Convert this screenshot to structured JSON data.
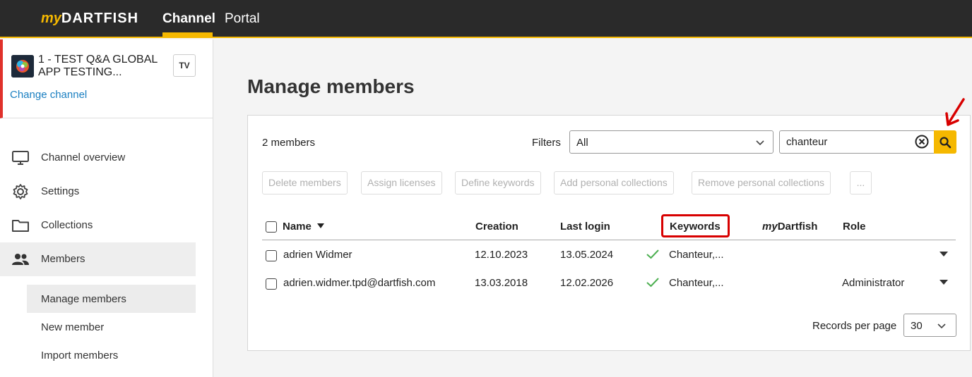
{
  "topbar": {
    "logo_my": "my",
    "logo_brand": "DARTFISH",
    "nav": {
      "channel": "Channel",
      "portal": "Portal"
    }
  },
  "sidebar": {
    "channel_name": "1 - TEST Q&A GLOBAL APP TESTING...",
    "tv_label": "TV",
    "change_channel": "Change channel",
    "menu": [
      {
        "label": "Channel overview",
        "icon": "monitor-icon"
      },
      {
        "label": "Settings",
        "icon": "gear-icon"
      },
      {
        "label": "Collections",
        "icon": "folder-icon"
      },
      {
        "label": "Members",
        "icon": "users-icon"
      }
    ],
    "submenu": [
      {
        "label": "Manage members"
      },
      {
        "label": "New member"
      },
      {
        "label": "Import members"
      }
    ]
  },
  "main": {
    "title": "Manage members",
    "members_count": "2  members",
    "filters_label": "Filters",
    "filter_value": "All",
    "search_value": "chanteur",
    "actions": [
      "Delete members",
      "Assign licenses",
      "Define keywords",
      "Add personal collections",
      "Remove personal collections",
      "..."
    ],
    "columns": {
      "name": "Name",
      "creation": "Creation",
      "last_login": "Last login",
      "keywords": "Keywords",
      "mydartfish_my": "my",
      "mydartfish_rest": "Dartfish",
      "role": "Role"
    },
    "rows": [
      {
        "name": "adrien Widmer",
        "creation": "12.10.2023",
        "last_login": "13.05.2024",
        "keywords": "Chanteur,...",
        "role": ""
      },
      {
        "name": "adrien.widmer.tpd@dartfish.com",
        "creation": "13.03.2018",
        "last_login": "12.02.2026",
        "keywords": "Chanteur,...",
        "role": "Administrator"
      }
    ],
    "records_label": "Records per page",
    "records_value": "30"
  },
  "colors": {
    "accent": "#f5b800",
    "topbar": "#2a2a2a",
    "highlight": "#d80000",
    "link": "#1a7fc1",
    "check": "#4caf50"
  }
}
